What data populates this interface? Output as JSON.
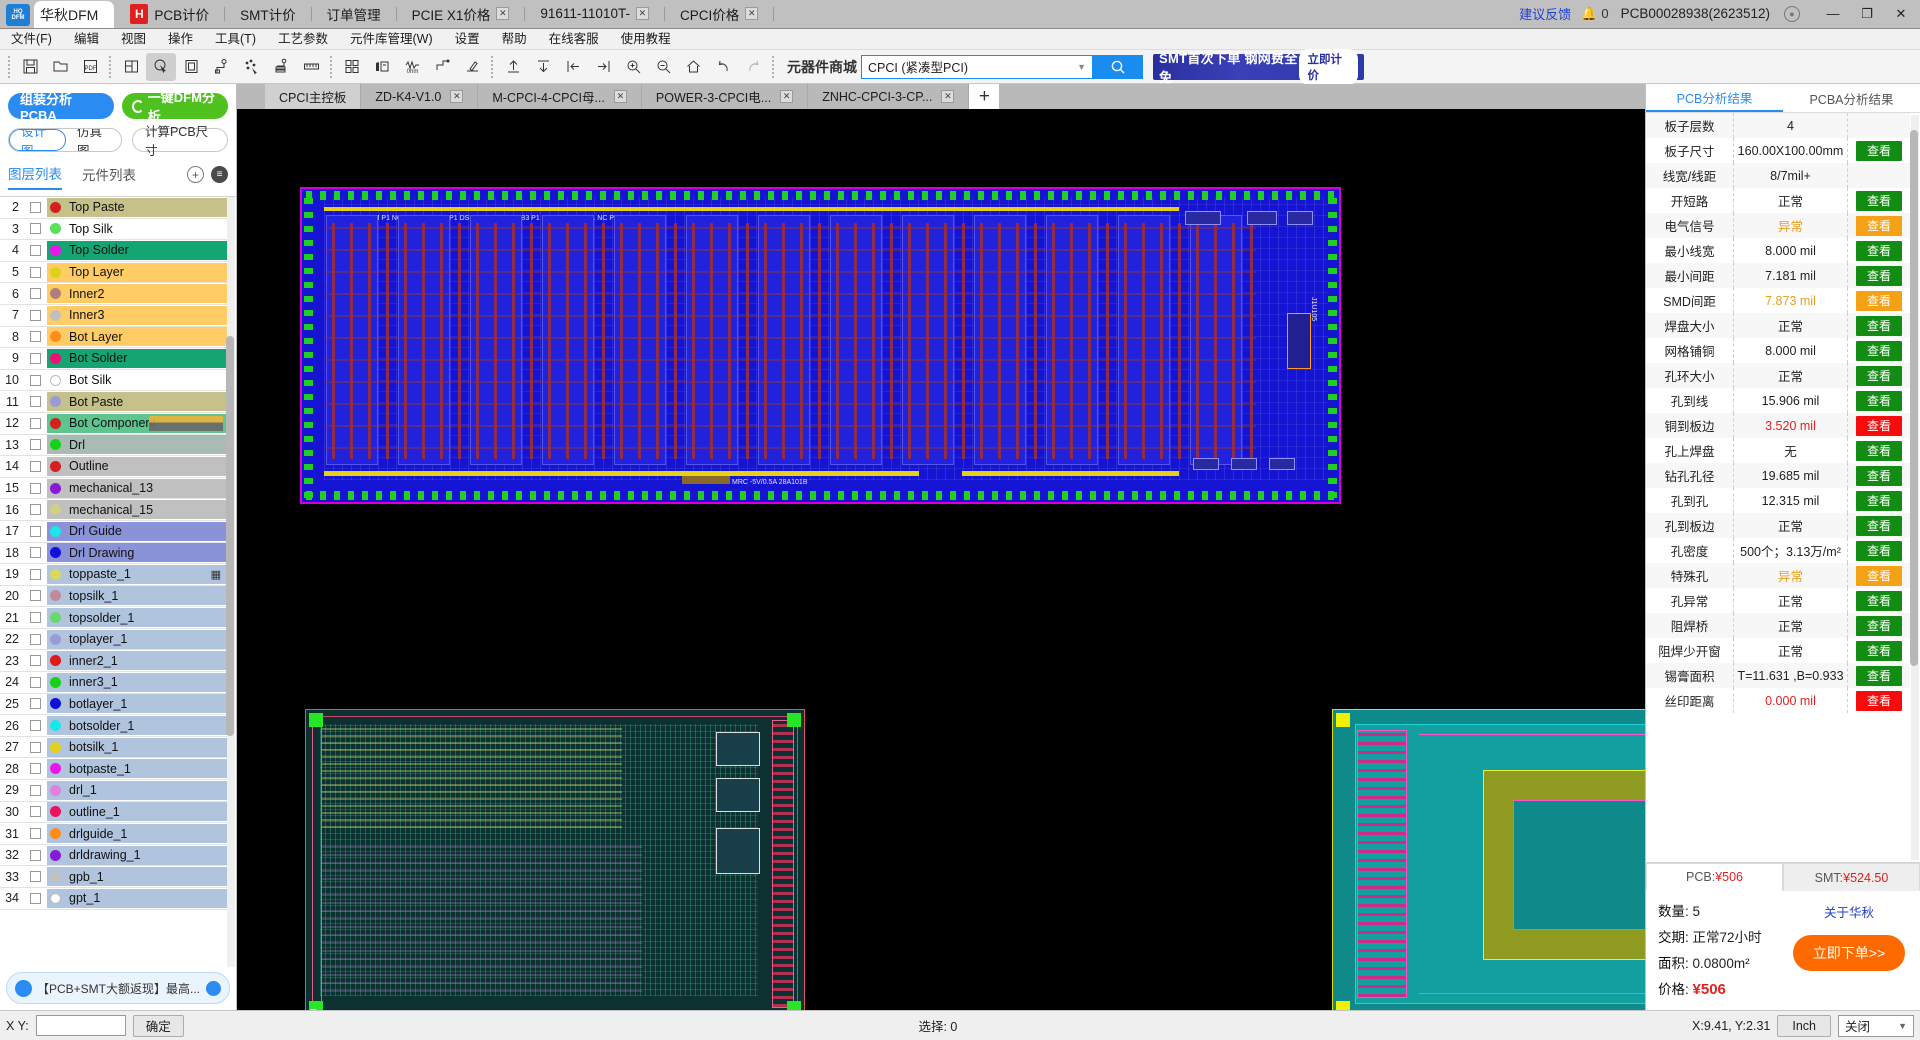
{
  "titlebar": {
    "app_name": "华秋DFM",
    "logo_text": "HQ DFM",
    "tabs": [
      {
        "label": "PCB计价",
        "closable": false,
        "icon": "hot-icon"
      },
      {
        "label": "SMT计价",
        "closable": false
      },
      {
        "label": "订单管理",
        "closable": false
      },
      {
        "label": "PCIE X1价格",
        "closable": true
      },
      {
        "label": "91611-11010T-",
        "closable": true
      },
      {
        "label": "CPCI价格",
        "closable": true
      }
    ],
    "feedback": "建议反馈",
    "bell_icon": "bell-icon",
    "notification_count": "0",
    "pcb_id": "PCB00028938(2623512)",
    "user_icon": "user-icon",
    "minimize": "—",
    "maximize": "❐",
    "close": "✕"
  },
  "menubar": {
    "items": [
      "文件(F)",
      "编辑",
      "视图",
      "操作",
      "工具(T)",
      "工艺参数",
      "元件库管理(W)",
      "设置",
      "帮助",
      "在线客服",
      "使用教程"
    ]
  },
  "toolbar": {
    "mall_label": "元器件商城",
    "mall_value": "CPCI (紧凑型PCI)",
    "search_icon": "search-icon",
    "banner_text": "SMT首次下单 钢网费全免",
    "banner_cta": "立即计价",
    "icons": [
      "save-icon",
      "open-folder-icon",
      "export-pdf-icon",
      "panel-icon",
      "select-cursor-icon",
      "board-icon",
      "measure-net-icon",
      "scatter-icon",
      "layers-stack-icon",
      "ruler-icon",
      "grid-compare-icon",
      "bom-icon",
      "impedance-icon",
      "route-icon",
      "probe-icon",
      "up-arrow-icon",
      "down-arrow-icon",
      "align-left-icon",
      "align-right-icon",
      "zoom-in-icon",
      "zoom-out-icon",
      "home-icon",
      "undo-icon",
      "redo-icon"
    ]
  },
  "left_panel": {
    "assembly_button": "组装分析 PCBA",
    "dfm_button": "一键DFM分析",
    "segment": [
      {
        "label": "设计图",
        "selected": true
      },
      {
        "label": "仿真图",
        "selected": false
      }
    ],
    "calc_button": "计算PCB尺寸",
    "tabs": [
      {
        "label": "图层列表",
        "selected": true
      },
      {
        "label": "元件列表",
        "selected": false
      }
    ],
    "add_icon": "plus-circle-icon",
    "stack_icon": "layers-circle-icon",
    "layers": [
      {
        "num": "2",
        "name": "Top Paste",
        "dot": "#d42020",
        "row_bg": "#c6c18a"
      },
      {
        "num": "3",
        "name": "Top Silk",
        "dot": "#5ce05c",
        "row_bg": "#ffffff"
      },
      {
        "num": "4",
        "name": "Top Solder",
        "dot": "#e817e8",
        "row_bg": "#15a573"
      },
      {
        "num": "5",
        "name": "Top Layer",
        "dot": "#e0d018",
        "row_bg": "#ffcc66"
      },
      {
        "num": "6",
        "name": "Inner2",
        "dot": "#b08080",
        "row_bg": "#ffcc66"
      },
      {
        "num": "7",
        "name": "Inner3",
        "dot": "#c0c0c0",
        "row_bg": "#ffcc66"
      },
      {
        "num": "8",
        "name": "Bot Layer",
        "dot": "#ff8c18",
        "row_bg": "#ffcc66"
      },
      {
        "num": "9",
        "name": "Bot Solder",
        "dot": "#ef1076",
        "row_bg": "#15a573"
      },
      {
        "num": "10",
        "name": "Bot Silk",
        "dot": "#ffffff",
        "row_bg": "#ffffff"
      },
      {
        "num": "11",
        "name": "Bot Paste",
        "dot": "#9a9ad8",
        "row_bg": "#c6c18a"
      },
      {
        "num": "12",
        "name": "Bot Component",
        "dot": "#d42020",
        "row_bg": "#5dc58d"
      },
      {
        "num": "13",
        "name": "Drl",
        "dot": "#18d018",
        "row_bg": "#a8bcb4"
      },
      {
        "num": "14",
        "name": "Outline",
        "dot": "#d42020",
        "row_bg": "#c0c0c0"
      },
      {
        "num": "15",
        "name": "mechanical_13",
        "dot": "#8a18d8",
        "row_bg": "#c0c0c0"
      },
      {
        "num": "16",
        "name": "mechanical_15",
        "dot": "#d0d08a",
        "row_bg": "#c0c0c0"
      },
      {
        "num": "17",
        "name": "Drl Guide",
        "dot": "#18e8e8",
        "row_bg": "#8a92d8"
      },
      {
        "num": "18",
        "name": "Drl Drawing",
        "dot": "#1010d8",
        "row_bg": "#8a92d8"
      },
      {
        "num": "19",
        "name": "toppaste_1",
        "dot": "#d8d860",
        "row_bg": "#b0c4de",
        "grid_icon": "grid-icon"
      },
      {
        "num": "20",
        "name": "topsilk_1",
        "dot": "#c08a9a",
        "row_bg": "#b0c4de"
      },
      {
        "num": "21",
        "name": "topsolder_1",
        "dot": "#6ad86a",
        "row_bg": "#b0c4de"
      },
      {
        "num": "22",
        "name": "toplayer_1",
        "dot": "#9a9ad8",
        "row_bg": "#b0c4de"
      },
      {
        "num": "23",
        "name": "inner2_1",
        "dot": "#e01818",
        "row_bg": "#b0c4de"
      },
      {
        "num": "24",
        "name": "inner3_1",
        "dot": "#18d018",
        "row_bg": "#b0c4de"
      },
      {
        "num": "25",
        "name": "botlayer_1",
        "dot": "#1010d8",
        "row_bg": "#b0c4de"
      },
      {
        "num": "26",
        "name": "botsolder_1",
        "dot": "#18e8e8",
        "row_bg": "#b0c4de"
      },
      {
        "num": "27",
        "name": "botsilk_1",
        "dot": "#e0d018",
        "row_bg": "#b0c4de"
      },
      {
        "num": "28",
        "name": "botpaste_1",
        "dot": "#e817e8",
        "row_bg": "#b0c4de"
      },
      {
        "num": "29",
        "name": "drl_1",
        "dot": "#e080e0",
        "row_bg": "#b0c4de"
      },
      {
        "num": "30",
        "name": "outline_1",
        "dot": "#ef1060",
        "row_bg": "#b0c4de"
      },
      {
        "num": "31",
        "name": "drlguide_1",
        "dot": "#ff8c18",
        "row_bg": "#b0c4de"
      },
      {
        "num": "32",
        "name": "drldrawing_1",
        "dot": "#8a18d8",
        "row_bg": "#b0c4de"
      },
      {
        "num": "33",
        "name": "gpb_1",
        "dot": "#c0c0c0",
        "row_bg": "#b0c4de"
      },
      {
        "num": "34",
        "name": "gpt_1",
        "dot": "#ffffff",
        "row_bg": "#b0c4de"
      }
    ],
    "promo_text": "【PCB+SMT大额返现】最高..."
  },
  "doc_tabs": [
    {
      "label": "CPCI主控板",
      "closable": false,
      "selected": true
    },
    {
      "label": "ZD-K4-V1.0",
      "closable": true,
      "selected": false
    },
    {
      "label": "M-CPCI-4-CPCI母...",
      "closable": true,
      "selected": false
    },
    {
      "label": "POWER-3-CPCI电...",
      "closable": true,
      "selected": false
    },
    {
      "label": "ZNHC-CPCI-3-CP...",
      "closable": true,
      "selected": false
    }
  ],
  "doc_tab_add": "+",
  "right_panel": {
    "tabs": [
      {
        "label": "PCB分析结果",
        "selected": true
      },
      {
        "label": "PCBA分析结果",
        "selected": false
      }
    ],
    "rows": [
      {
        "label": "板子层数",
        "value": "4",
        "value_color": "#222222",
        "action": "",
        "action_color": ""
      },
      {
        "label": "板子尺寸",
        "value": "160.00X100.00mm",
        "value_color": "#222222",
        "action": "查看",
        "action_color": "#138c13"
      },
      {
        "label": "线宽/线距",
        "value": "8/7mil+",
        "value_color": "#222222",
        "action": "",
        "action_color": ""
      },
      {
        "label": "开短路",
        "value": "正常",
        "value_color": "#222222",
        "action": "查看",
        "action_color": "#138c13"
      },
      {
        "label": "电气信号",
        "value": "异常",
        "value_color": "#e8a020",
        "action": "查看",
        "action_color": "#f5a116"
      },
      {
        "label": "最小线宽",
        "value": "8.000 mil",
        "value_color": "#222222",
        "action": "查看",
        "action_color": "#138c13"
      },
      {
        "label": "最小间距",
        "value": "7.181 mil",
        "value_color": "#222222",
        "action": "查看",
        "action_color": "#138c13"
      },
      {
        "label": "SMD间距",
        "value": "7.873 mil",
        "value_color": "#e8a020",
        "action": "查看",
        "action_color": "#f5a116"
      },
      {
        "label": "焊盘大小",
        "value": "正常",
        "value_color": "#222222",
        "action": "查看",
        "action_color": "#138c13"
      },
      {
        "label": "网格铺铜",
        "value": "8.000 mil",
        "value_color": "#222222",
        "action": "查看",
        "action_color": "#138c13"
      },
      {
        "label": "孔环大小",
        "value": "正常",
        "value_color": "#222222",
        "action": "查看",
        "action_color": "#138c13"
      },
      {
        "label": "孔到线",
        "value": "15.906 mil",
        "value_color": "#222222",
        "action": "查看",
        "action_color": "#138c13"
      },
      {
        "label": "铜到板边",
        "value": "3.520 mil",
        "value_color": "#e02020",
        "action": "查看",
        "action_color": "#f50c0c"
      },
      {
        "label": "孔上焊盘",
        "value": "无",
        "value_color": "#222222",
        "action": "查看",
        "action_color": "#138c13"
      },
      {
        "label": "钻孔孔径",
        "value": "19.685 mil",
        "value_color": "#222222",
        "action": "查看",
        "action_color": "#138c13"
      },
      {
        "label": "孔到孔",
        "value": "12.315 mil",
        "value_color": "#222222",
        "action": "查看",
        "action_color": "#138c13"
      },
      {
        "label": "孔到板边",
        "value": "正常",
        "value_color": "#222222",
        "action": "查看",
        "action_color": "#138c13"
      },
      {
        "label": "孔密度",
        "value": "500个；3.13万/m²",
        "value_color": "#222222",
        "action": "查看",
        "action_color": "#138c13"
      },
      {
        "label": "特殊孔",
        "value": "异常",
        "value_color": "#e8a020",
        "action": "查看",
        "action_color": "#f5a116"
      },
      {
        "label": "孔异常",
        "value": "正常",
        "value_color": "#222222",
        "action": "查看",
        "action_color": "#138c13"
      },
      {
        "label": "阻焊桥",
        "value": "正常",
        "value_color": "#222222",
        "action": "查看",
        "action_color": "#138c13"
      },
      {
        "label": "阻焊少开窗",
        "value": "正常",
        "value_color": "#222222",
        "action": "查看",
        "action_color": "#138c13"
      },
      {
        "label": "锡膏面积",
        "value": "T=11.631 ,B=0.933",
        "value_color": "#222222",
        "action": "查看",
        "action_color": "#138c13"
      },
      {
        "label": "丝印距离",
        "value": "0.000 mil",
        "value_color": "#e02020",
        "action": "查看",
        "action_color": "#f50c0c"
      }
    ],
    "price": {
      "tabs": [
        {
          "prefix": "PCB:",
          "amount": "¥506",
          "selected": true
        },
        {
          "prefix": "SMT:",
          "amount": "¥524.50",
          "selected": false
        }
      ],
      "qty_label": "数量:",
      "qty_value": "5",
      "lead_label": "交期:",
      "lead_value": "正常72小时",
      "area_label": "面积:",
      "area_value": "0.0800m²",
      "price_label": "价格:",
      "price_value": "¥506",
      "about_link": "关于华秋",
      "order_button": "立即下单>>"
    }
  },
  "statusbar": {
    "xy_label": "X Y:",
    "xy_value": "",
    "ok_button": "确定",
    "selection_label": "选择: 0",
    "coords": "X:9.41, Y:2.31",
    "unit_button": "Inch",
    "layer_select": "关闭"
  },
  "colors": {
    "accent_blue": "#2a8cf0",
    "green": "#138c13",
    "orange": "#f5a116",
    "red": "#e02020",
    "order_orange": "#ff6a00"
  }
}
